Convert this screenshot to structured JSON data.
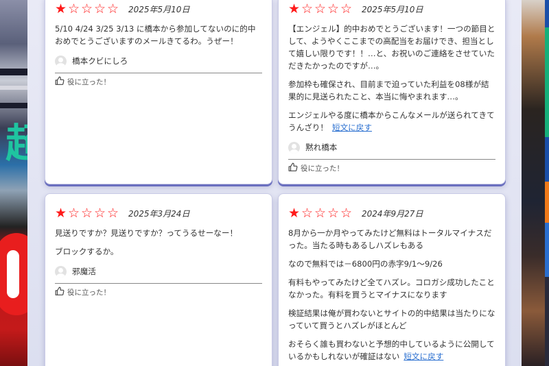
{
  "colors": {
    "star": "#ff1a1a",
    "link": "#2a6fd0",
    "card_shadow": "#6a6fbf"
  },
  "reviews": [
    {
      "rating": 1,
      "date": "2025年5月10日",
      "paragraphs": [
        "5/10 4/24 3/25 3/13 に橋本から参加してないのに的中おめでとうございますのメールきてるわ。うぜー！"
      ],
      "more_label": "",
      "user": "橋本クビにしろ",
      "helpful_label": "役に立った！"
    },
    {
      "rating": 1,
      "date": "2025年5月10日",
      "paragraphs": [
        "【エンジェル】的中おめでとうございます！一つの節目として、ようやくここまでの高配当をお届けでき、担当として嬉しい限りです！！…と、お祝いのご連絡をさせていただきたかったのですが…。",
        "参加枠も確保され、目前まで迫っていた利益を08様が結果的に見送られたこと、本当に悔やまれます…。",
        "エンジェルやる度に橋本からこんなメールが送られてきてうんざり！"
      ],
      "more_label": "短文に戻す",
      "user": "黙れ橋本",
      "helpful_label": "役に立った！"
    },
    {
      "rating": 1,
      "date": "2025年3月24日",
      "paragraphs": [
        "見送りですか？見送りですか？ってうるせーなー！",
        "ブロックするか。"
      ],
      "more_label": "",
      "user": "邪魔活",
      "helpful_label": "役に立った！"
    },
    {
      "rating": 1,
      "date": "2024年9月27日",
      "paragraphs": [
        "8月から一か月やってみたけど無料はトータルマイナスだった。当たる時もあるしハズレもある",
        "なので無料では－6800円の赤字9/1〜9/26",
        "有料もやってみたけど全てハズレ。コロガシ成功したことなかった。有料を買うとマイナスになります",
        "検証結果は俺が買わないとサイトの的中結果は当たりになっていて買うとハズレがほとんど",
        "おそらく誰も買わないと予想的中しているように公開しているかもしれないが確証はない"
      ],
      "more_label": "短文に戻す",
      "user": "",
      "helpful_label": ""
    }
  ],
  "icons": {
    "avatar": "user-avatar-icon",
    "helpful": "thumbs-up-icon",
    "star_filled": "star-filled-icon",
    "star_empty": "star-empty-icon"
  }
}
